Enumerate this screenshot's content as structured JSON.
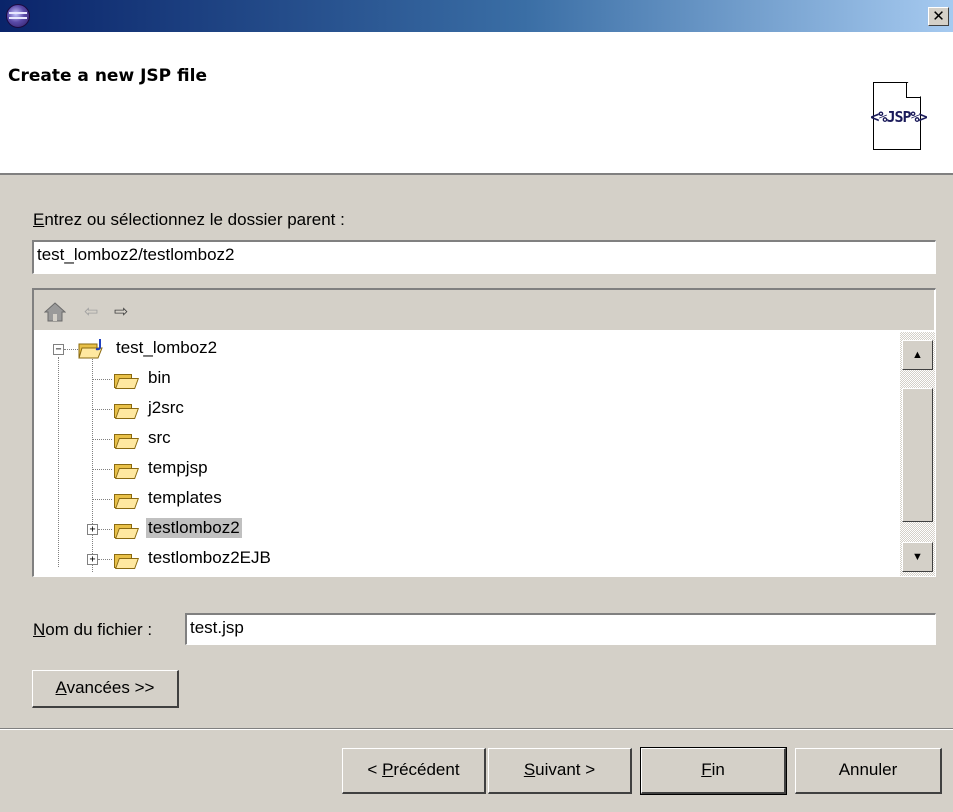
{
  "window": {
    "close_glyph": "✕"
  },
  "header": {
    "title": "Create a new JSP file",
    "badge": {
      "text": "<%JSP%>"
    }
  },
  "parent_folder": {
    "label_accel": "E",
    "label_rest": "ntrez ou sélectionnez le dossier parent :",
    "value": "test_lomboz2/testlomboz2"
  },
  "tree_nav": {
    "home_icon": "house-icon",
    "back_glyph": "⇦",
    "forward_glyph": "⇨"
  },
  "tree": {
    "root": {
      "label": "test_lomboz2",
      "expander": "−"
    },
    "items": [
      {
        "label": "bin"
      },
      {
        "label": "j2src"
      },
      {
        "label": "src"
      },
      {
        "label": "tempjsp"
      },
      {
        "label": "templates"
      },
      {
        "label": "testlomboz2",
        "expander": "+",
        "selected": true
      },
      {
        "label": "testlomboz2EJB",
        "expander": "+"
      }
    ]
  },
  "scrollbar": {
    "up_glyph": "▲",
    "down_glyph": "▼"
  },
  "file_name": {
    "label_accel": "N",
    "label_rest": "om du fichier :",
    "value": "test.jsp"
  },
  "advanced": {
    "accel": "A",
    "rest": "vancées >>"
  },
  "buttons": {
    "back": {
      "prefix": "< ",
      "accel": "P",
      "rest": "récédent"
    },
    "next": {
      "accel": "S",
      "rest": "uivant >"
    },
    "finish": {
      "accel": "F",
      "rest": "in"
    },
    "cancel": {
      "label": "Annuler"
    }
  }
}
